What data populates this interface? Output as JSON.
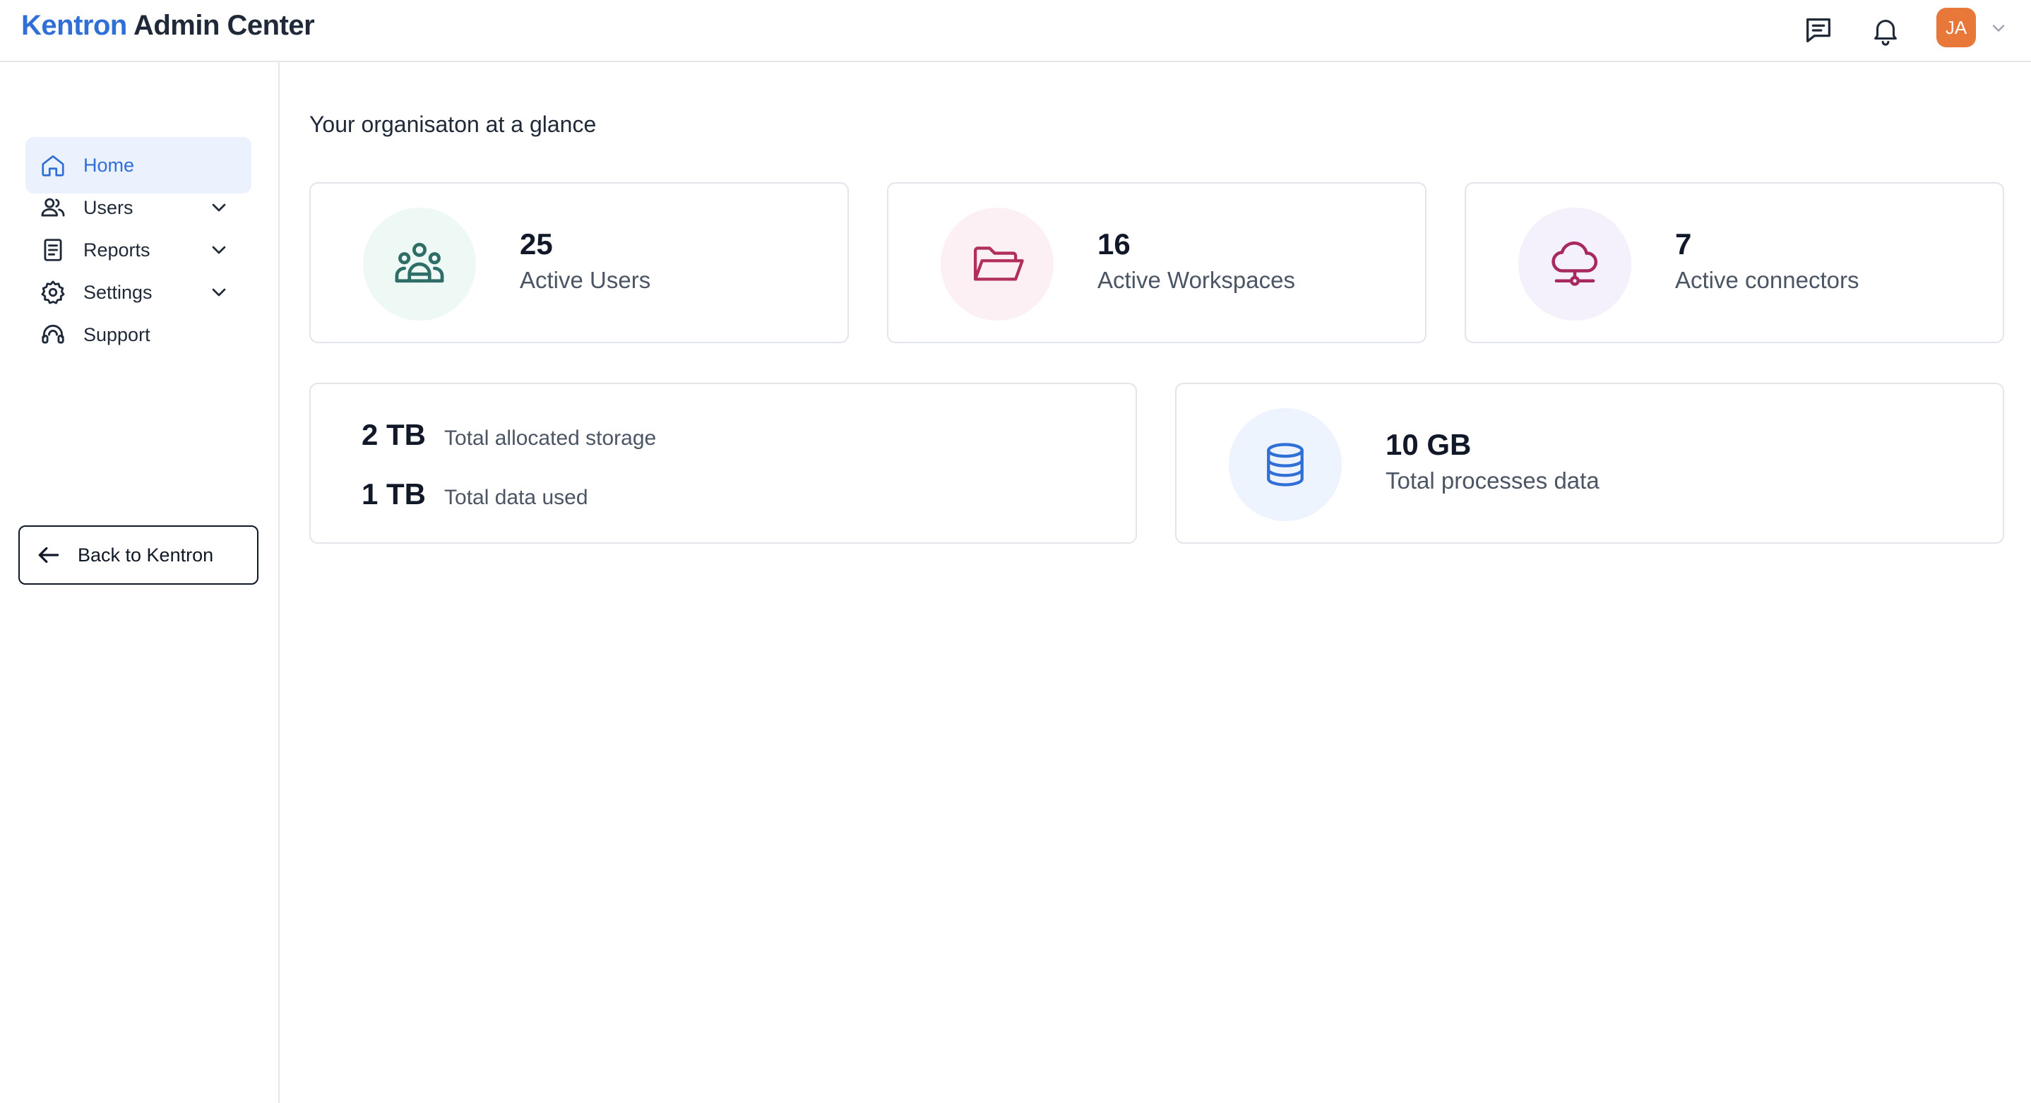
{
  "header": {
    "brand_accent": "Kentron",
    "brand_rest": "Admin Center",
    "avatar_initials": "JA",
    "icons": [
      "chat-icon",
      "bell-icon",
      "chevron-down-icon"
    ]
  },
  "sidebar": {
    "items": [
      {
        "label": "Home",
        "icon": "home-icon",
        "active": true
      },
      {
        "label": "Users",
        "icon": "users-icon",
        "expandable": true
      },
      {
        "label": "Reports",
        "icon": "report-icon",
        "expandable": true
      },
      {
        "label": "Settings",
        "icon": "gear-icon",
        "expandable": true
      },
      {
        "label": "Support",
        "icon": "headset-icon"
      }
    ],
    "back_label": "Back to Kentron"
  },
  "main": {
    "title": "Your organisaton at a glance",
    "stats": [
      {
        "value": "25",
        "label": "Active Users",
        "icon": "users-group-icon"
      },
      {
        "value": "16",
        "label": "Active Workspaces",
        "icon": "folder-icon"
      },
      {
        "value": "7",
        "label": "Active connectors",
        "icon": "cloud-network-icon"
      }
    ],
    "storage": {
      "allocated_value": "2 TB",
      "allocated_label": "Total allocated storage",
      "used_value": "1 TB",
      "used_label": "Total data used"
    },
    "processed": {
      "value": "10 GB",
      "label": "Total processes data",
      "icon": "database-icon"
    }
  },
  "colors": {
    "accent": "#2f6fd6",
    "avatar": "#e8773a",
    "users_icon": "#2f6e66",
    "folder_icon": "#b0305a",
    "cloud_icon": "#a82a5c",
    "database_icon": "#2f6fd6"
  }
}
